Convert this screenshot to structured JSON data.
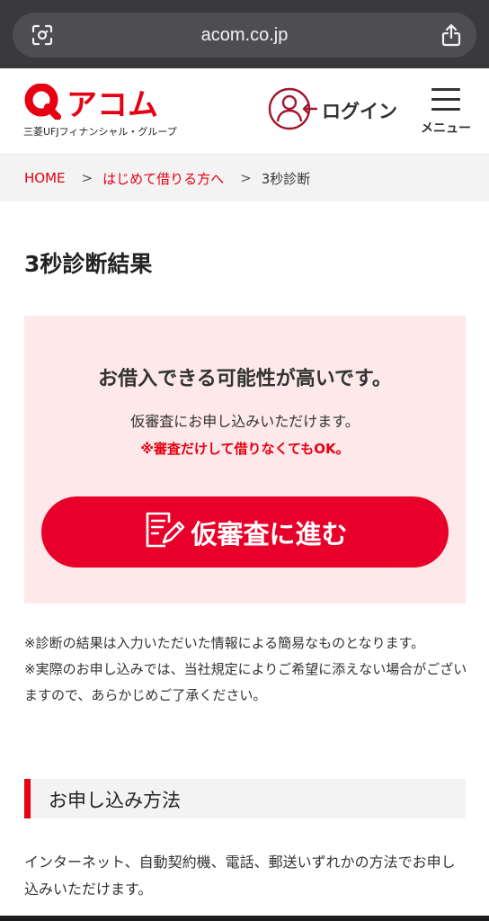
{
  "browser": {
    "url": "acom.co.jp",
    "lens_icon": "camera-lens-icon",
    "share_icon": "share-icon"
  },
  "header": {
    "logo_text": "アコム",
    "logo_sub": "三菱UFJフィナンシャル・グループ",
    "login_label": "ログイン",
    "menu_label": "メニュー",
    "brand_color": "#e60012"
  },
  "breadcrumb": {
    "items": [
      "HOME",
      "はじめて借りる方へ"
    ],
    "current": "3秒診断",
    "separator": ">"
  },
  "page": {
    "title": "3秒診断結果"
  },
  "result": {
    "headline": "お借入できる可能性が高いです。",
    "line": "仮審査にお申し込みいただけます。",
    "note": "※審査だけして借りなくてもOK。",
    "cta_label": "仮審査に進む",
    "cta_color": "#e8002a",
    "box_color": "#fde8ea"
  },
  "notes": {
    "note1": "※診断の結果は入力いただいた情報による簡易なものとなります。",
    "note2": "※実際のお申し込みでは、当社規定によりご希望に添えない場合がございますので、あらかじめご了承ください。"
  },
  "section": {
    "title": "お申し込み方法",
    "body": "インターネット、自動契約機、電話、郵送いずれかの方法でお申し込みいただけます。"
  }
}
